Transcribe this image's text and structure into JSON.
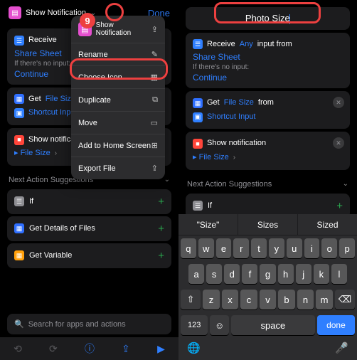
{
  "left": {
    "title": "Show Notification",
    "done": "Done",
    "card1": {
      "receive": "Receive",
      "share": "Share Sheet",
      "noinput": "If there's no input:",
      "cont": "Continue"
    },
    "card2": {
      "get": "Get",
      "fs": "File Size",
      "from": "from",
      "si": "Shortcut Input"
    },
    "card3": {
      "sn": "Show notification",
      "fs": "File Size"
    },
    "menu": {
      "title": "Show Notification",
      "rename": "Rename",
      "icon": "Choose Icon",
      "dup": "Duplicate",
      "move": "Move",
      "home": "Add to Home Screen",
      "export": "Export File"
    },
    "sect": "Next Action Suggestions",
    "s1": "If",
    "s2": "Get Details of Files",
    "s3": "Get Variable",
    "search": "Search for apps and actions"
  },
  "right": {
    "titleval": "Photo Size",
    "card1": {
      "receive": "Receive",
      "any": "Any",
      "inputfrom": "input from",
      "share": "Share Sheet",
      "noinput": "If there's no input:",
      "cont": "Continue"
    },
    "card2": {
      "get": "Get",
      "fs": "File Size",
      "from": "from",
      "si": "Shortcut Input"
    },
    "card3": {
      "sn": "Show notification",
      "fs": "File Size"
    },
    "sect": "Next Action Suggestions",
    "s1": "If",
    "sug1": "\"Size\"",
    "sug2": "Sizes",
    "sug3": "Sized",
    "space": "space",
    "donek": "done",
    "numk": "123"
  }
}
